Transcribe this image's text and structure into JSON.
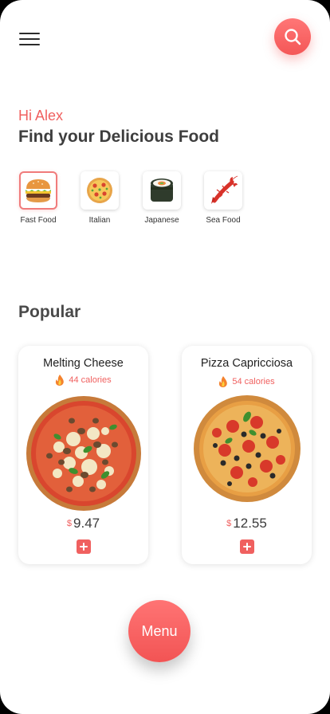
{
  "header": {
    "menu_icon": "hamburger-icon",
    "search_icon": "search-icon",
    "greeting": "Hi Alex",
    "headline": "Find your Delicious Food"
  },
  "categories": [
    {
      "label": "Fast Food",
      "icon": "burger-icon",
      "selected": true
    },
    {
      "label": "Italian",
      "icon": "pizza-icon",
      "selected": false
    },
    {
      "label": "Japanese",
      "icon": "sushi-icon",
      "selected": false
    },
    {
      "label": "Sea Food",
      "icon": "lobster-icon",
      "selected": false
    }
  ],
  "popular": {
    "title": "Popular",
    "items": [
      {
        "name": "Melting Cheese",
        "calories": "44 calories",
        "currency": "$",
        "price": "9.47",
        "image": "pizza-image"
      },
      {
        "name": "Pizza Capricciosa",
        "calories": "54 calories",
        "currency": "$",
        "price": "12.55",
        "image": "pizza-image"
      }
    ]
  },
  "footer": {
    "menu_label": "Menu"
  },
  "colors": {
    "accent": "#f0605f",
    "text_dark": "#3e3e3e"
  }
}
